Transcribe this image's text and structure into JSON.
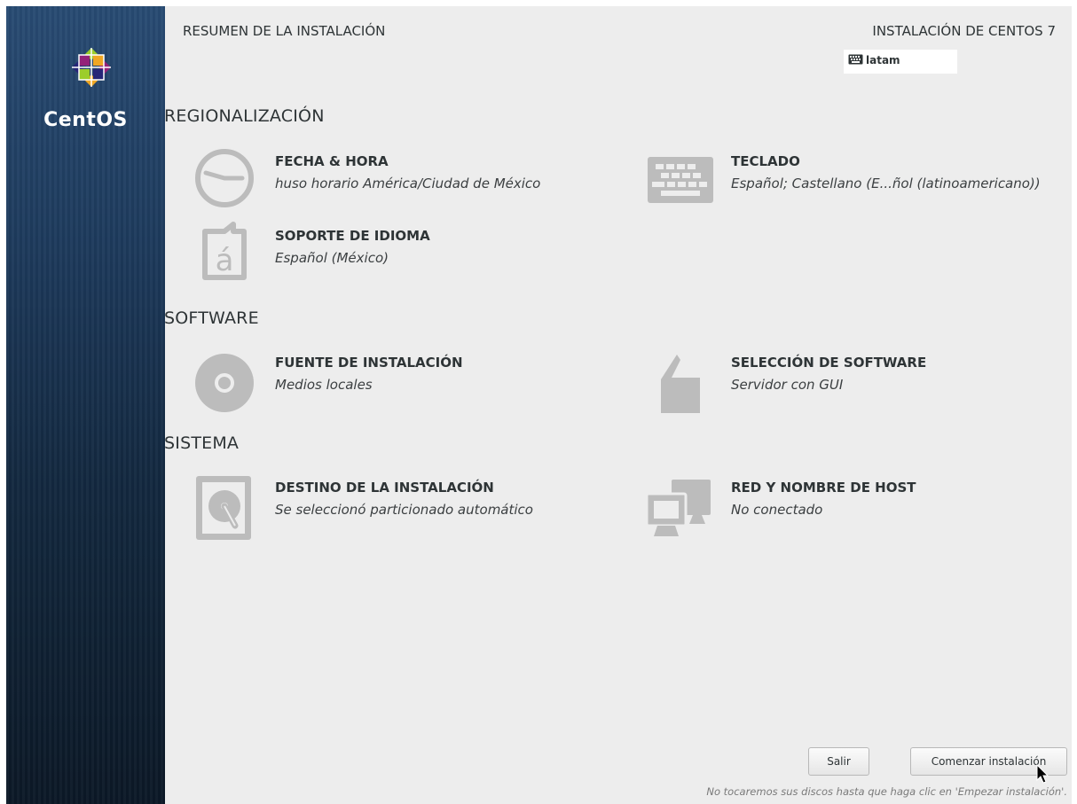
{
  "sidebar": {
    "brand": "CentOS",
    "logo_icon": "centos-logo-icon"
  },
  "header": {
    "title": "RESUMEN DE LA INSTALACIÓN",
    "product": "INSTALACIÓN DE CENTOS 7",
    "keyboard_layout": "latam",
    "keyboard_icon": "keyboard-icon"
  },
  "sections": {
    "localization": {
      "title": "REGIONALIZACIÓN",
      "date_time": {
        "title": "FECHA & HORA",
        "status": "huso horario América/Ciudad de México",
        "icon": "clock-icon"
      },
      "keyboard": {
        "title": "TECLADO",
        "status": "Español; Castellano (E...ñol (latinoamericano))",
        "icon": "keyboard-icon"
      },
      "language": {
        "title": "SOPORTE DE IDIOMA",
        "status": "Español (México)",
        "icon": "language-icon"
      }
    },
    "software": {
      "title": "SOFTWARE",
      "source": {
        "title": "FUENTE DE INSTALACIÓN",
        "status": "Medios locales",
        "icon": "disc-icon"
      },
      "selection": {
        "title": "SELECCIÓN DE SOFTWARE",
        "status": "Servidor con GUI",
        "icon": "package-icon"
      }
    },
    "system": {
      "title": "SISTEMA",
      "destination": {
        "title": "DESTINO DE LA INSTALACIÓN",
        "status": "Se seleccionó particionado automático",
        "icon": "hard-disk-icon"
      },
      "network": {
        "title": "RED Y NOMBRE DE HOST",
        "status": "No conectado",
        "icon": "network-icon"
      }
    }
  },
  "footer": {
    "quit_label": "Salir",
    "begin_label": "Comenzar instalación",
    "note": "No tocaremos sus discos hasta que haga clic en 'Empezar instalación'."
  },
  "colors": {
    "sidebar_top": "#284b73",
    "sidebar_bottom": "#0b1826",
    "main_background": "#ededed",
    "icon_gray": "#bcbcbc",
    "text": "#2e3436"
  }
}
